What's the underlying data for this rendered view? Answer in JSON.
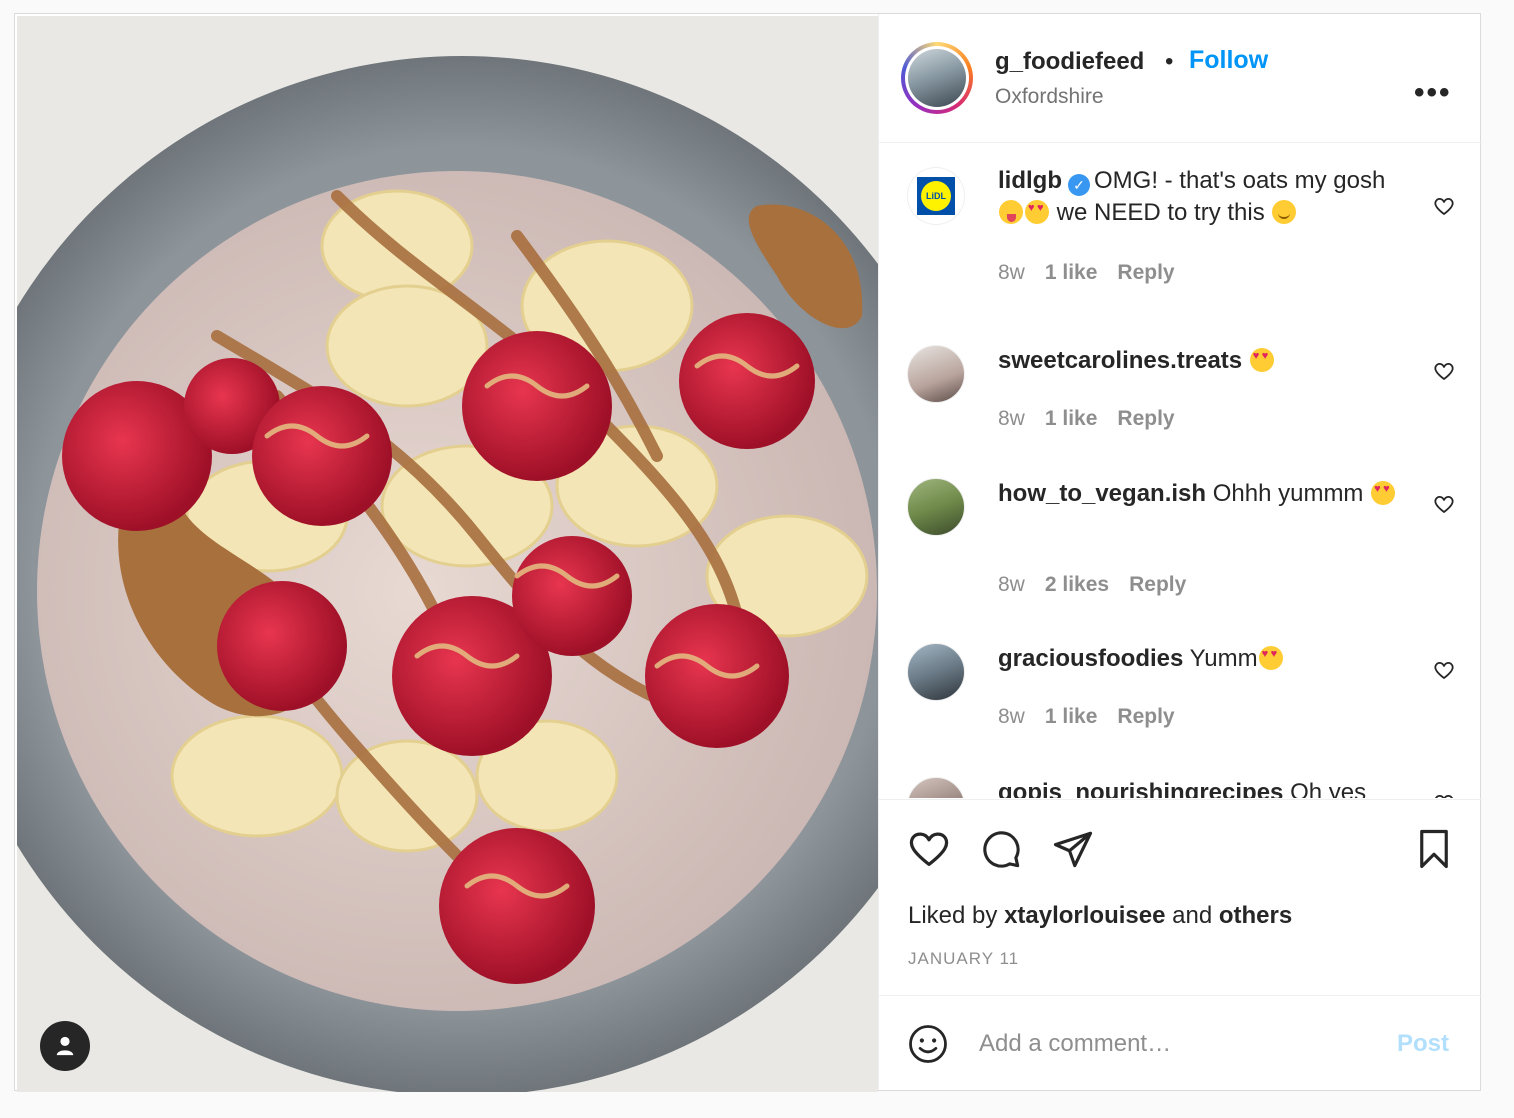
{
  "post": {
    "username": "g_foodiefeed",
    "separator": "•",
    "follow_label": "Follow",
    "location": "Oxfordshire",
    "more_label": "•••"
  },
  "comments": [
    {
      "username": "lidlgb",
      "verified": true,
      "text_part1": "OMG! - that's oats my gosh ",
      "text_part2": " we NEED to try this ",
      "age": "8w",
      "likes": "1 like",
      "reply": "Reply",
      "avatar_text": "LiDL"
    },
    {
      "username": "sweetcarolines.treats",
      "text": "",
      "age": "8w",
      "likes": "1 like",
      "reply": "Reply"
    },
    {
      "username": "how_to_vegan.ish",
      "text": "Ohhh yummm",
      "age": "8w",
      "likes": "2 likes",
      "reply": "Reply"
    },
    {
      "username": "graciousfoodies",
      "text": "Yumm",
      "age": "8w",
      "likes": "1 like",
      "reply": "Reply"
    },
    {
      "username": "gopis_nourishingrecipes",
      "text": "Oh yes"
    }
  ],
  "footer": {
    "liked_prefix": "Liked by",
    "liked_user": "xtaylorlouisee",
    "liked_and": "and",
    "liked_others": "others",
    "date": "JANUARY 11",
    "comment_placeholder": "Add a comment…",
    "post_label": "Post"
  },
  "colors": {
    "accent": "#0095f6",
    "post_disabled": "#b2dffc",
    "verified": "#3897f0",
    "muted": "#8e8e8e"
  },
  "icons": [
    "tag-user-icon",
    "more-icon",
    "verified-icon",
    "heart-icon",
    "comment-icon",
    "share-icon",
    "bookmark-icon",
    "emoji-icon"
  ]
}
